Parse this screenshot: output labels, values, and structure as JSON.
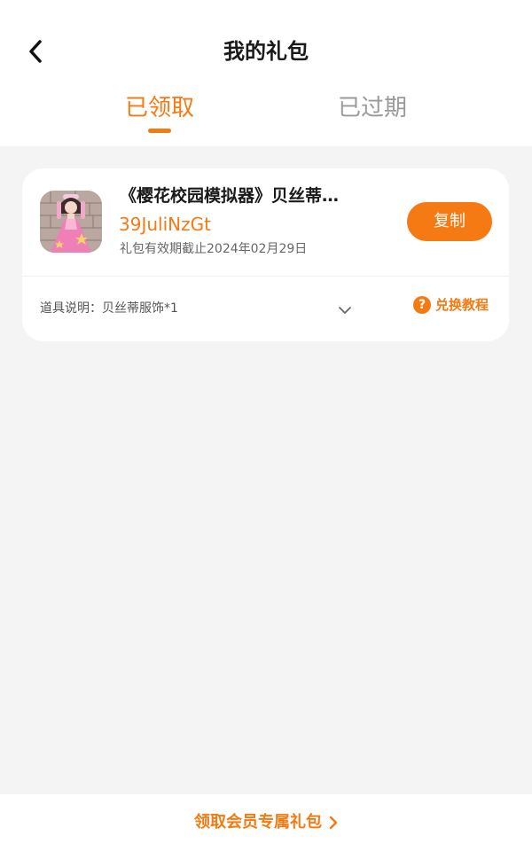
{
  "header": {
    "title": "我的礼包",
    "back_icon": "chevron-left-icon"
  },
  "tabs": [
    {
      "label": "已领取",
      "active": true
    },
    {
      "label": "已过期",
      "active": false
    }
  ],
  "colors": {
    "accent": "#f57a13",
    "background": "#f4f4f4",
    "card": "#ffffff",
    "tab_inactive": "#9a9a9a"
  },
  "gift": {
    "title": "《樱花校园模拟器》贝丝蒂…",
    "code": "39JuliNzGt",
    "expiry": "礼包有效期截止2024年02月29日",
    "copy_label": "复制",
    "item_description": "道具说明：贝丝蒂服饰*1",
    "tutorial_label": "兑换教程",
    "expand_icon": "chevron-down-icon",
    "help_icon": "question-circle-icon",
    "game_icon": "game-character-icon"
  },
  "footer": {
    "member_link_label": "领取会员专属礼包",
    "member_link_icon": "chevron-right-icon"
  }
}
